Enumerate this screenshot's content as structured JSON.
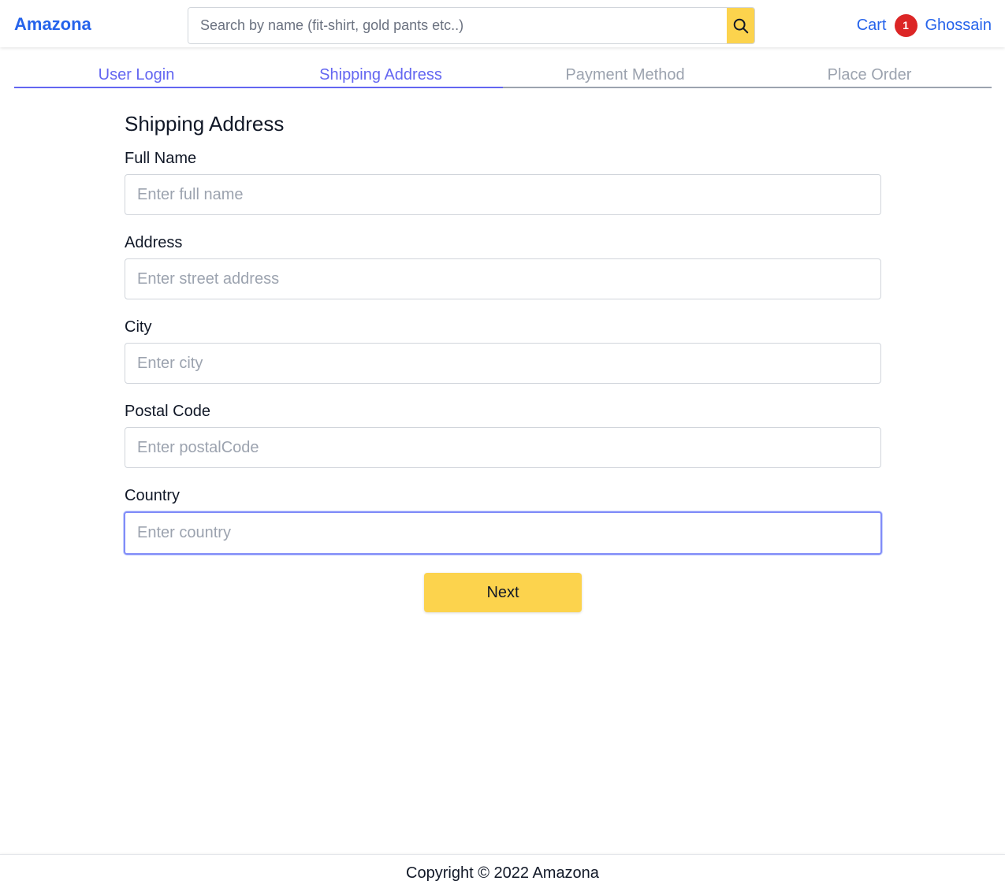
{
  "header": {
    "brand": "Amazona",
    "search_placeholder": "Search by name (fit-shirt, gold pants etc..)",
    "search_icon": "search-icon",
    "cart_label": "Cart",
    "cart_count": "1",
    "user_name": "Ghossain"
  },
  "steps": [
    {
      "label": "User Login",
      "active": true
    },
    {
      "label": "Shipping Address",
      "active": true
    },
    {
      "label": "Payment Method",
      "active": false
    },
    {
      "label": "Place Order",
      "active": false
    }
  ],
  "form": {
    "title": "Shipping Address",
    "fields": [
      {
        "label": "Full Name",
        "placeholder": "Enter full name",
        "value": ""
      },
      {
        "label": "Address",
        "placeholder": "Enter street address",
        "value": ""
      },
      {
        "label": "City",
        "placeholder": "Enter city",
        "value": ""
      },
      {
        "label": "Postal Code",
        "placeholder": "Enter postalCode",
        "value": ""
      },
      {
        "label": "Country",
        "placeholder": "Enter country",
        "value": ""
      }
    ],
    "submit_label": "Next"
  },
  "footer": {
    "text": "Copyright © 2022 Amazona"
  },
  "colors": {
    "brand": "#2563eb",
    "accent": "#fcd34d",
    "step_active": "#6366f1",
    "step_inactive": "#9ca3af",
    "badge": "#dc2626"
  }
}
